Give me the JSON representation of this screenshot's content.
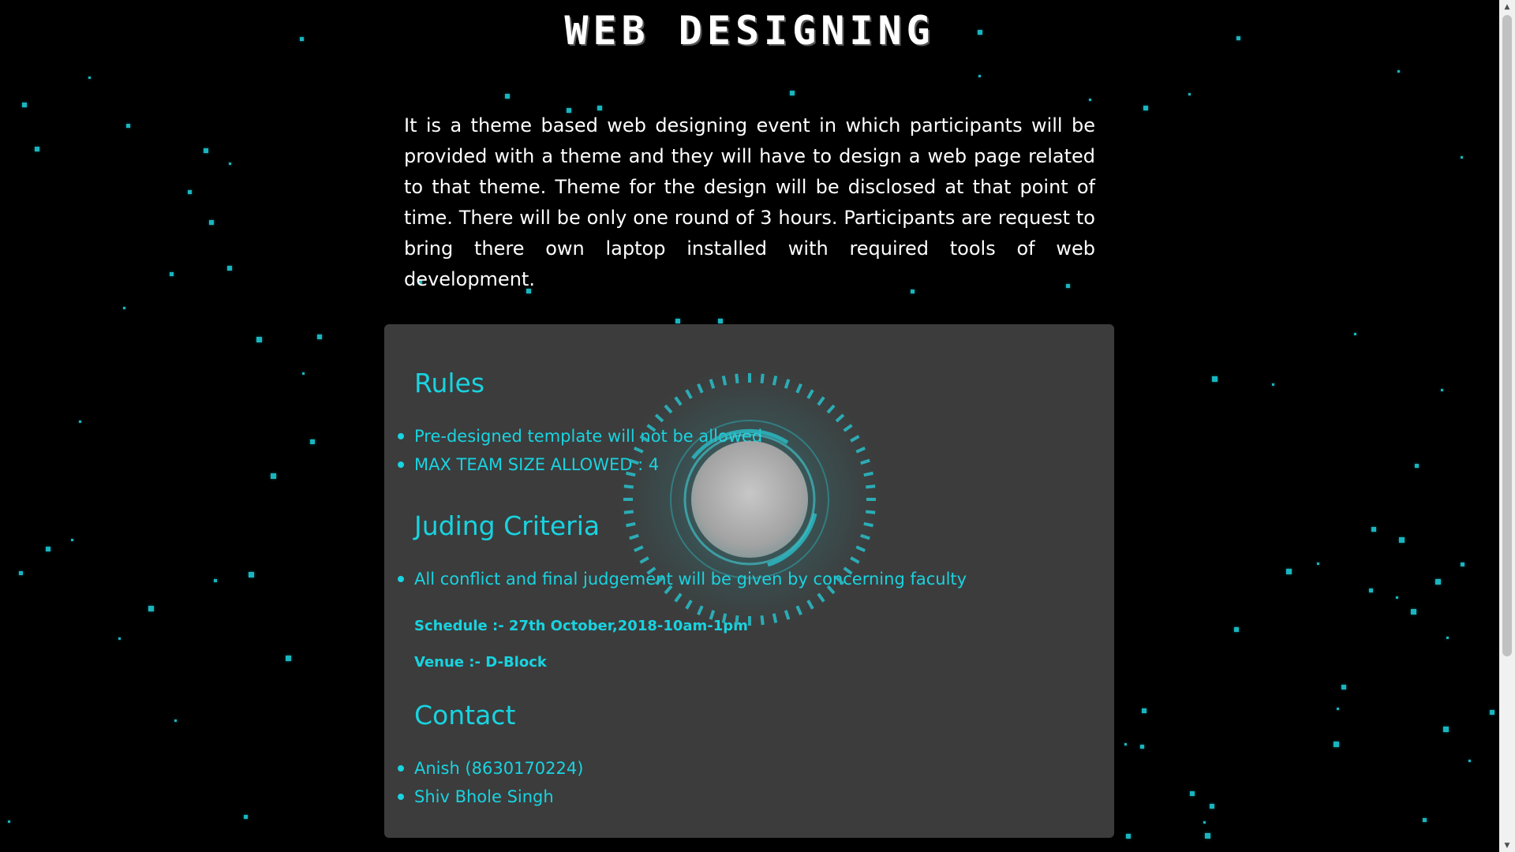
{
  "page": {
    "title": "WEB DESIGNING",
    "description": "It is a theme based web designing event in which participants will be provided with a theme and they will have to design a web page related to that theme. Theme for the design will be disclosed at that point of time. There will be only one round of 3 hours. Participants are request to bring there own laptop installed with required tools of web development."
  },
  "card": {
    "rules_heading": "Rules",
    "rules": [
      "Pre-designed template will not be allowed",
      "MAX TEAM SIZE ALLOWED : 4"
    ],
    "judging_heading": "Juding Criteria",
    "judging": [
      "All conflict and final judgement will be given by concerning faculty"
    ],
    "schedule": "Schedule :- 27th October,2018-10am-1pm",
    "venue": "Venue :- D-Block",
    "contact_heading": "Contact",
    "contacts": [
      "Anish (8630170224)",
      "Shiv Bhole Singh"
    ]
  },
  "scrollbar": {
    "up_icon": "triangle-up-icon",
    "down_icon": "triangle-down-icon"
  },
  "colors": {
    "accent": "#19d3e0",
    "star": "#19b5bf",
    "card_bg": "#3c3c3c",
    "page_bg": "#000000"
  }
}
